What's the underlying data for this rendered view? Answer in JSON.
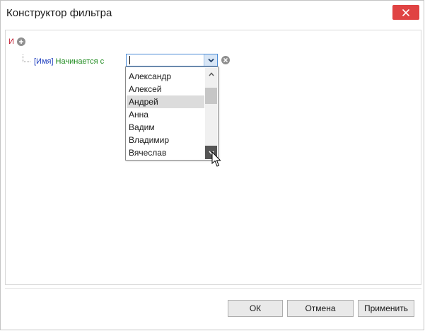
{
  "window": {
    "title": "Конструктор фильтра"
  },
  "filter": {
    "root_operator": "И",
    "condition": {
      "field": "[Имя]",
      "operator": "Начинается с",
      "value": ""
    }
  },
  "dropdown": {
    "items": [
      "Александр",
      "Алексей",
      "Андрей",
      "Анна",
      "Вадим",
      "Владимир",
      "Вячеслав"
    ],
    "selected_item": "Андрей"
  },
  "buttons": {
    "ok": "ОК",
    "cancel": "Отмена",
    "apply": "Применить"
  },
  "colors": {
    "close_button": "#e04343",
    "operator_and": "#c0142a",
    "field_name": "#1f3fbf",
    "operator_name": "#1c8a1c",
    "combo_border": "#4a8bd6"
  },
  "icons": {
    "close": "close-icon",
    "add": "plus-circle-icon",
    "remove": "x-circle-icon",
    "combo": "chevron-down-icon",
    "scroll_up": "chevron-up-icon",
    "scroll_down": "chevron-down-icon",
    "pointer": "mouse-pointer-icon"
  }
}
